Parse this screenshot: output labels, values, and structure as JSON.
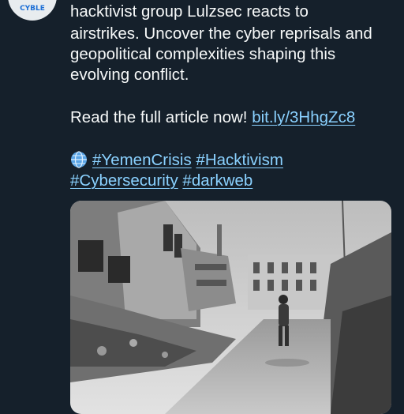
{
  "tweet": {
    "line1": "hacktivist group Lulzsec reacts to",
    "para2": "airstrikes. Uncover the cyber reprisals and geopolitical complexities shaping this evolving conflict.",
    "read_more_prefix": "Read the full article now! ",
    "link_text": "bit.ly/3HhgZc8",
    "hashtags": [
      "#YemenCrisis",
      "#Hacktivism",
      "#Cybersecurity",
      "#darkweb"
    ]
  },
  "avatar": {
    "logo_text": "CYBLE"
  },
  "colors": {
    "background": "#15202b",
    "link": "#8ad1ff",
    "text": "#f7f9f9"
  },
  "media": {
    "icon": "photo-of-destroyed-buildings"
  }
}
